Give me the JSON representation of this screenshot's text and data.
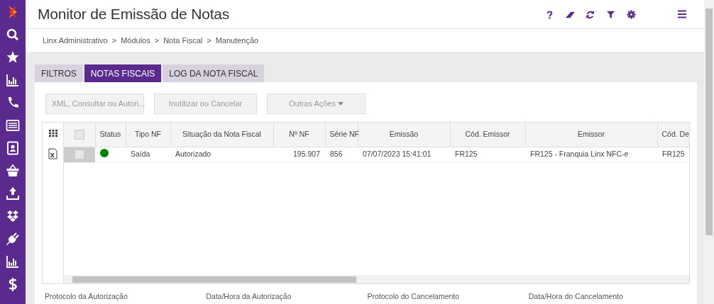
{
  "sidebar": {
    "items": [
      {
        "kind": "logo"
      },
      {
        "kind": "search"
      },
      {
        "kind": "star"
      },
      {
        "kind": "chart"
      },
      {
        "kind": "phone"
      },
      {
        "kind": "list"
      },
      {
        "kind": "contact"
      },
      {
        "kind": "basket"
      },
      {
        "kind": "upload"
      },
      {
        "kind": "boxes"
      },
      {
        "kind": "plug"
      },
      {
        "kind": "chart"
      },
      {
        "kind": "dollar"
      }
    ]
  },
  "header": {
    "title": "Monitor de Emissão de Notas",
    "tools": [
      {
        "kind": "help"
      },
      {
        "kind": "eraser"
      },
      {
        "kind": "refresh"
      },
      {
        "kind": "filter"
      },
      {
        "kind": "settings"
      },
      {
        "kind": "menu"
      }
    ]
  },
  "breadcrumb": [
    "Linx Administrativo",
    "Módulos",
    "Nota Fiscal",
    "Manutenção"
  ],
  "breadcrumb_separator": ">",
  "tabs": [
    {
      "label": "FILTROS",
      "selected": false
    },
    {
      "label": "NOTAS FISCAIS",
      "selected": true
    },
    {
      "label": "LOG DA NOTA FISCAL",
      "selected": false
    }
  ],
  "actions": [
    {
      "kind": "button",
      "label": "XML, Consultar ou Autori..."
    },
    {
      "kind": "button",
      "label": "Inutilizar ou Cancelar"
    },
    {
      "kind": "dropdown",
      "label": "Outras Ações"
    }
  ],
  "table": {
    "select_all_checked": false,
    "columns": [
      "Status",
      "Tipo NF",
      "Situação da Nota Fiscal",
      "Nº NF",
      "Série NF",
      "Emissão",
      "Cód. Emissor",
      "Emissor",
      "Cód. De"
    ],
    "rows": [
      {
        "checked": false,
        "color": "#008000",
        "cells": [
          "",
          "Saída",
          "Autorizado",
          "195.907",
          "856",
          "07/07/2023 15:41:01",
          "FR125",
          "FR125 - Franquia Linx NFC-e",
          "FR125"
        ]
      }
    ]
  },
  "details": [
    "Protocolo da Autorização",
    "Data/Hora da Autorização",
    "Protocolo do Cancelamento",
    "Data/Hora do Cancelamento"
  ]
}
